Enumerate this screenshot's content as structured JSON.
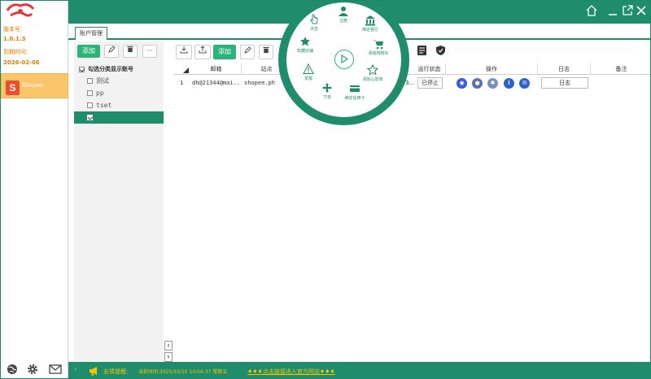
{
  "sidebar": {
    "version_label": "版本号：",
    "version": "1.0.1.3",
    "expire_label": "到期时间：",
    "expire_date": "2026-02-06",
    "platform": {
      "icon": "S",
      "label": "Shopee"
    }
  },
  "tabs": [
    {
      "label": "账户管理"
    }
  ],
  "category_panel": {
    "add_label": "添加",
    "more_label": "···",
    "header": "勾选分类显示账号",
    "items": [
      {
        "label": "测试",
        "checked": false
      },
      {
        "label": "pp",
        "checked": false
      },
      {
        "label": "tset",
        "checked": false
      },
      {
        "label": "",
        "checked": true
      }
    ]
  },
  "toolbar": {
    "add_label": "添加"
  },
  "table": {
    "columns": [
      "邮箱",
      "站点",
      "运行状态",
      "操作",
      "日志",
      "备注"
    ],
    "rows": [
      {
        "index": "1",
        "email": "dh@21344@mai...",
        "site": "shopee.ph",
        "extra": "3...",
        "status": "已停止",
        "log": "日志",
        "note": ""
      }
    ]
  },
  "radial_menu": {
    "items": [
      {
        "label": "注册",
        "icon": "person-icon"
      },
      {
        "label": "绑定银行",
        "icon": "bank-icon"
      },
      {
        "label": "添加购物车",
        "icon": "cart-icon"
      },
      {
        "label": "添加心愿单",
        "icon": "star-outline-icon"
      },
      {
        "label": "绑定信用卡",
        "icon": "credit-card-icon"
      },
      {
        "label": "下单",
        "icon": "move-icon"
      },
      {
        "label": "举报",
        "icon": "warning-icon"
      },
      {
        "label": "收藏店铺",
        "icon": "star-icon"
      },
      {
        "label": "点击",
        "icon": "pointer-icon"
      }
    ]
  },
  "footer": {
    "label": "友情提醒:",
    "time_text": "当前时间:2025/10/10  10:04:37 星期五",
    "link_text": "♦♦♦点击链接进入官方网站♦♦♦"
  },
  "colors": {
    "primary": "#1f8c6c",
    "accent_green": "#2bb37a",
    "version_orange": "#e07f00",
    "footer_yellow": "#f5c500",
    "platform_bg": "#fbc56a"
  }
}
